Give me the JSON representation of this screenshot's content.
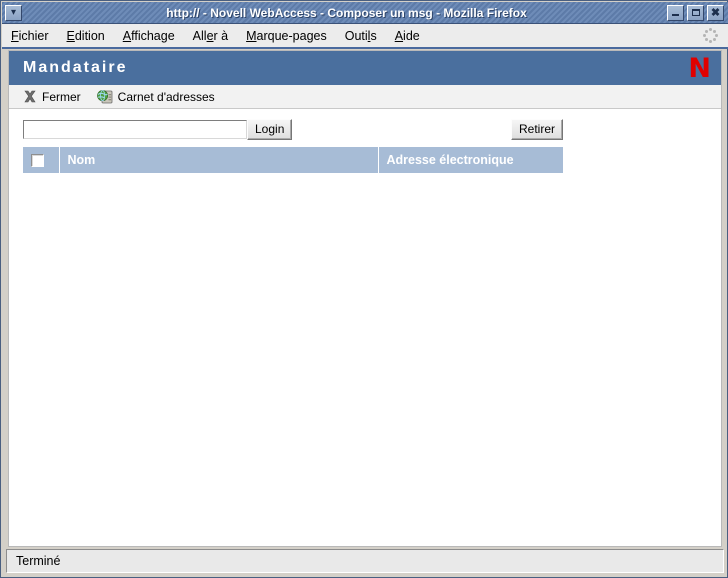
{
  "window": {
    "title": "http://               - Novell WebAccess - Composer un msg - Mozilla Firefox",
    "sysmenu_glyph": "▾",
    "controls": {
      "minimize": "minimize-button",
      "maximize": "maximize-button",
      "close": "close-button"
    }
  },
  "menubar": {
    "items": [
      {
        "accel": "F",
        "rest": "ichier"
      },
      {
        "accel": "E",
        "rest": "dition"
      },
      {
        "accel": "A",
        "rest": "ffichage"
      },
      {
        "pre": "All",
        "accel": "e",
        "rest": "r à"
      },
      {
        "accel": "M",
        "rest": "arque-pages"
      },
      {
        "pre": "Outi",
        "accel": "l",
        "rest": "s"
      },
      {
        "accel": "A",
        "rest": "ide"
      }
    ],
    "throbber": "throbber-icon"
  },
  "app": {
    "header_title": "Mandataire",
    "logo_letter": "N",
    "logo_color": "#e00000",
    "header_color": "#4a6f9e",
    "toolbar": [
      {
        "label": "Fermer",
        "icon": "close-x-icon"
      },
      {
        "label": "Carnet d'adresses",
        "icon": "address-book-icon"
      }
    ]
  },
  "form": {
    "login_value": "",
    "login_placeholder": "",
    "login_button": "Login",
    "remove_button": "Retirer"
  },
  "table": {
    "columns": [
      "",
      "Nom",
      "Adresse électronique"
    ],
    "rows": []
  },
  "statusbar": {
    "text": "Terminé"
  }
}
